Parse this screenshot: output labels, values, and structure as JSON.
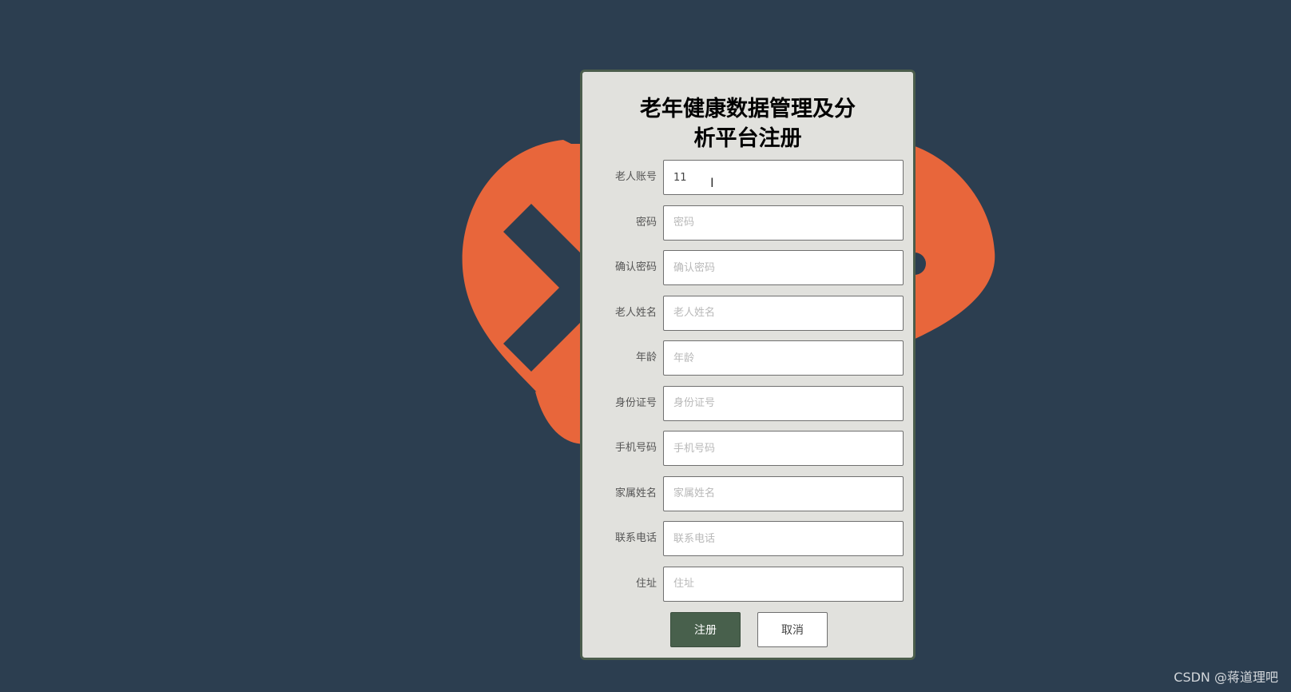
{
  "page": {
    "title": "老年健康数据管理及分\n析平台注册",
    "background_color": "#2c3e50",
    "accent_color": "#48604c",
    "logo_color": "#e8663b",
    "panel_color": "#e1e1dd"
  },
  "form": {
    "fields": [
      {
        "label": "老人账号",
        "value": "11",
        "placeholder": ""
      },
      {
        "label": "密码",
        "value": "",
        "placeholder": "密码"
      },
      {
        "label": "确认密码",
        "value": "",
        "placeholder": "确认密码"
      },
      {
        "label": "老人姓名",
        "value": "",
        "placeholder": "老人姓名"
      },
      {
        "label": "年龄",
        "value": "",
        "placeholder": "年龄"
      },
      {
        "label": "身份证号",
        "value": "",
        "placeholder": "身份证号"
      },
      {
        "label": "手机号码",
        "value": "",
        "placeholder": "手机号码"
      },
      {
        "label": "家属姓名",
        "value": "",
        "placeholder": "家属姓名"
      },
      {
        "label": "联系电话",
        "value": "",
        "placeholder": "联系电话"
      },
      {
        "label": "住址",
        "value": "",
        "placeholder": "住址"
      }
    ]
  },
  "buttons": {
    "register": "注册",
    "cancel": "取消"
  },
  "watermark": {
    "text": "CSDN @蒋道理吧"
  },
  "icons": {
    "background": "health-cross-logo-icon",
    "cursor": "text-cursor-icon"
  }
}
